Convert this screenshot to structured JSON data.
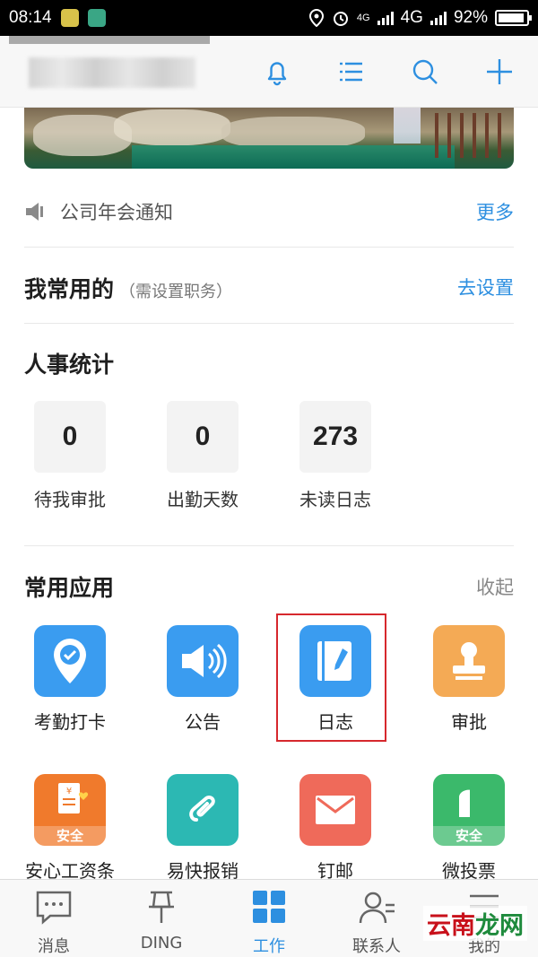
{
  "status_bar": {
    "time": "08:14",
    "network1": "4G",
    "network2": "4G",
    "battery": "92%",
    "battery_level": 0.92
  },
  "header": {
    "icons": [
      "bell-icon",
      "list-icon",
      "search-icon",
      "plus-icon"
    ]
  },
  "notice": {
    "text": "公司年会通知",
    "more": "更多"
  },
  "favorites": {
    "title": "我常用的",
    "subtitle": "（需设置职务）",
    "action": "去设置"
  },
  "hr_stats": {
    "title": "人事统计",
    "items": [
      {
        "value": "0",
        "label": "待我审批"
      },
      {
        "value": "0",
        "label": "出勤天数"
      },
      {
        "value": "273",
        "label": "未读日志"
      }
    ]
  },
  "apps": {
    "title": "常用应用",
    "collapse": "收起",
    "items": [
      {
        "label": "考勤打卡",
        "icon": "location-check-icon",
        "color": "#3a9cf0"
      },
      {
        "label": "公告",
        "icon": "megaphone-icon",
        "color": "#3a9cf0"
      },
      {
        "label": "日志",
        "icon": "notebook-pen-icon",
        "color": "#3a9cf0"
      },
      {
        "label": "审批",
        "icon": "stamp-icon",
        "color": "#f4aa55"
      },
      {
        "label": "安心工资条",
        "icon": "payslip-icon",
        "color": "#f07a2c",
        "badge": "安全"
      },
      {
        "label": "易快报销",
        "icon": "paperclip-icon",
        "color": "#2cb8b3"
      },
      {
        "label": "钉邮",
        "icon": "mail-icon",
        "color": "#ef6a5a"
      },
      {
        "label": "微投票",
        "icon": "vote-icon",
        "color": "#3bb96b",
        "badge": "安全"
      }
    ]
  },
  "tabs": [
    {
      "label": "消息",
      "icon": "chat-icon"
    },
    {
      "label": "DING",
      "icon": "pin-icon"
    },
    {
      "label": "工作",
      "icon": "grid-icon"
    },
    {
      "label": "联系人",
      "icon": "contacts-icon"
    },
    {
      "label": "我的",
      "icon": "menu-icon"
    }
  ],
  "watermark": {
    "part1": "云南",
    "part2": "龙网"
  },
  "colors": {
    "accent": "#2d8fe0",
    "highlight_border": "#d6282d"
  }
}
